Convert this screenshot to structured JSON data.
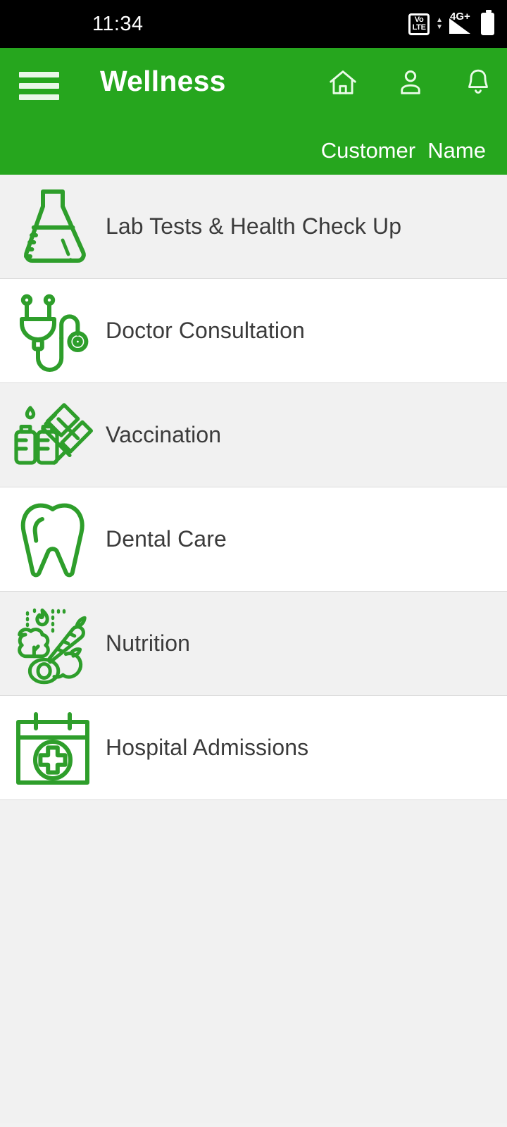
{
  "status_bar": {
    "time": "11:34",
    "volte_top": "Vo",
    "volte_bottom": "LTE",
    "network_label": "4G+",
    "icons": [
      "volte-icon",
      "data-transfer-icon",
      "signal-icon",
      "battery-icon"
    ]
  },
  "app_bar": {
    "menu_icon": "hamburger-menu-icon",
    "title": "Wellness",
    "actions": [
      {
        "name": "home-icon",
        "label": "Home"
      },
      {
        "name": "profile-icon",
        "label": "Profile"
      },
      {
        "name": "notifications-bell-icon",
        "label": "Notifications"
      }
    ],
    "user_name": "Customer  Name"
  },
  "colors": {
    "brand_green": "#26a61e",
    "icon_green": "#2e9e2b",
    "row_alt": "#f1f1f1",
    "row_plain": "#ffffff",
    "text_dark": "#3b3b3b",
    "status_bar_bg": "#000000"
  },
  "services": [
    {
      "label": "Lab Tests & Health Check Up",
      "icon": "flask-icon"
    },
    {
      "label": "Doctor Consultation",
      "icon": "stethoscope-icon"
    },
    {
      "label": "Vaccination",
      "icon": "syringe-vials-icon"
    },
    {
      "label": "Dental Care",
      "icon": "tooth-icon"
    },
    {
      "label": "Nutrition",
      "icon": "vegetables-icon"
    },
    {
      "label": "Hospital Admissions",
      "icon": "calendar-medical-cross-icon"
    }
  ]
}
